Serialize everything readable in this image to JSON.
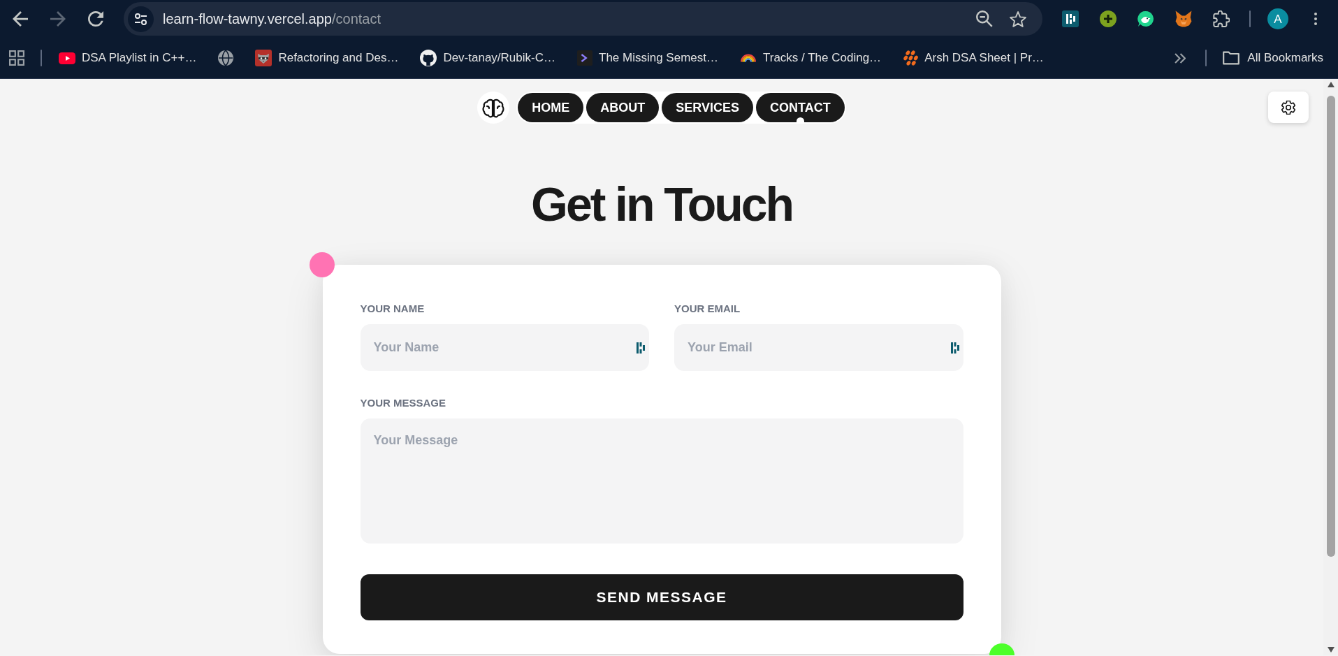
{
  "browser": {
    "nav_buttons": [
      {
        "kind": "back",
        "disabled": false
      },
      {
        "kind": "forward",
        "disabled": true
      },
      {
        "kind": "reload",
        "disabled": false
      }
    ],
    "address_bar": {
      "host": "learn-flow-tawny.vercel.app",
      "path": "/contact"
    },
    "profile": {
      "initial": "A"
    },
    "bookmarks": [
      {
        "kind": "video",
        "label": "DSA Playlist in C++…"
      },
      {
        "kind": "globe"
      },
      {
        "kind": "raccoon",
        "label": "Refactoring and Des…"
      },
      {
        "kind": "cat",
        "label": "Dev-tanay/Rubik-C…"
      },
      {
        "kind": "prompt",
        "label": "The Missing Semest…"
      },
      {
        "kind": "rainbow",
        "label": "Tracks / The Coding…"
      },
      {
        "kind": "dots",
        "label": "Arsh DSA Sheet | Pr…"
      }
    ],
    "all_bookmarks": "All Bookmarks"
  },
  "nav": {
    "links": [
      {
        "label": "HOME",
        "selected": false
      },
      {
        "label": "ABOUT",
        "selected": false
      },
      {
        "label": "SERVICES",
        "selected": false
      },
      {
        "label": "CONTACT",
        "selected": true
      }
    ]
  },
  "heading": "Get in Touch",
  "form": {
    "fields": [
      {
        "kind": "input",
        "label": "YOUR NAME",
        "placeholder": "Your Name"
      },
      {
        "kind": "input",
        "label": "YOUR EMAIL",
        "placeholder": "Your Email"
      },
      {
        "kind": "textarea",
        "label": "YOUR MESSAGE",
        "placeholder": "Your Message"
      }
    ],
    "submit": "SEND MESSAGE"
  }
}
